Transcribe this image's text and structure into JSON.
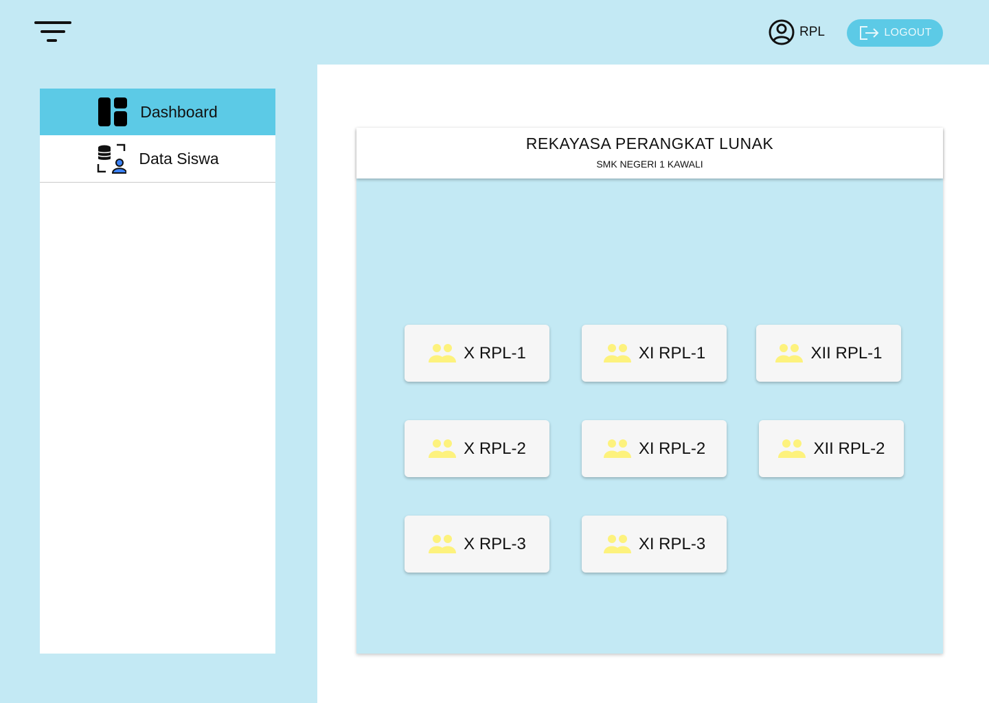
{
  "header": {
    "menu_icon": "filter-menu-icon",
    "user_icon": "user-circle-icon",
    "user_label": "RPL",
    "logout_icon": "logout-icon",
    "logout_label": "LOGOUT"
  },
  "sidebar": {
    "items": [
      {
        "label": "Dashboard",
        "icon": "dashboard-icon",
        "active": true
      },
      {
        "label": "Data Siswa",
        "icon": "student-database-icon",
        "active": false
      }
    ]
  },
  "main": {
    "title": "REKAYASA PERANGKAT LUNAK",
    "subtitle": "SMK NEGERI 1 KAWALI",
    "classes": [
      {
        "label": "X RPL-1",
        "icon": "users-icon"
      },
      {
        "label": "XI RPL-1",
        "icon": "users-icon"
      },
      {
        "label": "XII RPL-1",
        "icon": "users-icon"
      },
      {
        "label": "X RPL-2",
        "icon": "users-icon"
      },
      {
        "label": "XI RPL-2",
        "icon": "users-icon"
      },
      {
        "label": "XII RPL-2",
        "icon": "users-icon"
      },
      {
        "label": "X RPL-3",
        "icon": "users-icon"
      },
      {
        "label": "XI RPL-3",
        "icon": "users-icon"
      }
    ]
  },
  "colors": {
    "background": "#c3e9f4",
    "accent": "#5ccae6",
    "group_icon": "#fdf27d",
    "card": "#f6f6f6"
  }
}
